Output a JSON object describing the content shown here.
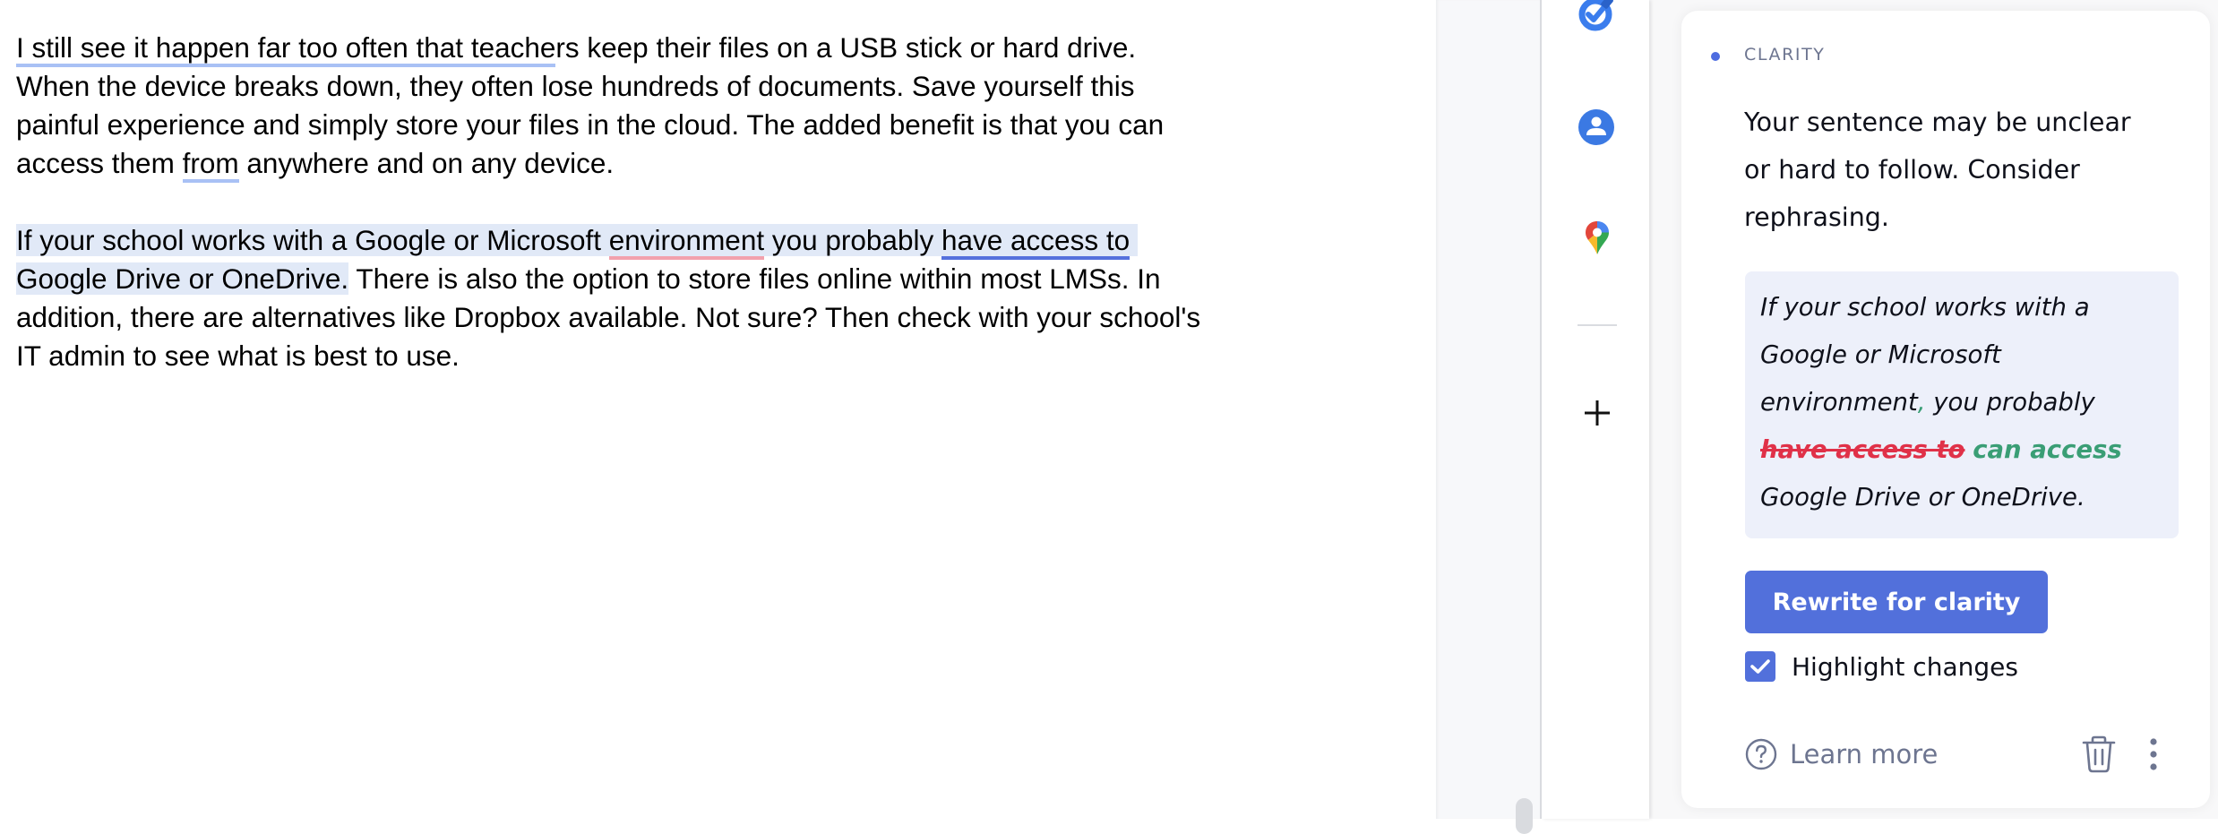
{
  "document": {
    "paragraphs": [
      {
        "lines": [
          [
            {
              "text": "I still see it happen far too often that teache",
              "style": "ul-light"
            },
            {
              "text": "rs keep their files on a USB stick or hard drive.",
              "style": ""
            }
          ],
          [
            {
              "text": "When the device breaks down, they often lose hundreds of documents. Save yourself this",
              "style": ""
            }
          ],
          [
            {
              "text": "painful experience and simply store your files in the cloud. The added benefit is that you can",
              "style": ""
            }
          ],
          [
            {
              "text": "access them ",
              "style": ""
            },
            {
              "text": "from",
              "style": "ul-light"
            },
            {
              "text": " anywhere and on any device.",
              "style": ""
            }
          ]
        ]
      },
      {
        "lines": [
          [
            {
              "text": "If your school works with a Google or Microsoft ",
              "style": "hl"
            },
            {
              "text": "environment",
              "style": "hl ul-pink"
            },
            {
              "text": " you probably ",
              "style": "hl"
            },
            {
              "text": "have access to",
              "style": "hl ul-blue"
            },
            {
              "text": " ",
              "style": "hl"
            }
          ],
          [
            {
              "text": "Google Drive or OneDrive.",
              "style": "hl"
            },
            {
              "text": " There is also the option to store files online within most LMSs. In",
              "style": ""
            }
          ],
          [
            {
              "text": "addition, there are alternatives like Dropbox available. Not sure? Then check with your school's",
              "style": ""
            }
          ],
          [
            {
              "text": "IT admin to see what is best to use.",
              "style": ""
            }
          ]
        ]
      }
    ]
  },
  "rail": {
    "icons": [
      "google-tasks-icon",
      "google-contacts-icon",
      "google-maps-icon"
    ],
    "add_label": "+"
  },
  "panel": {
    "category": "CLARITY",
    "message": "Your sentence may be unclear or hard to follow. Consider rephrasing.",
    "suggestion": {
      "before_1": "If your school works with a Google or Microsoft environment",
      "inserted_punct": ",",
      "before_2": " you probably ",
      "deleted": "have access to",
      "inserted": "can access",
      "after": " Google Drive or OneDrive."
    },
    "rewrite_button": "Rewrite for clarity",
    "highlight_changes": {
      "label": "Highlight changes",
      "checked": true
    },
    "learn_more": "Learn more",
    "colors": {
      "accent": "#5270db",
      "deleted": "#e03148",
      "inserted": "#3a9e75",
      "highlight": "#e1e9f7"
    }
  }
}
